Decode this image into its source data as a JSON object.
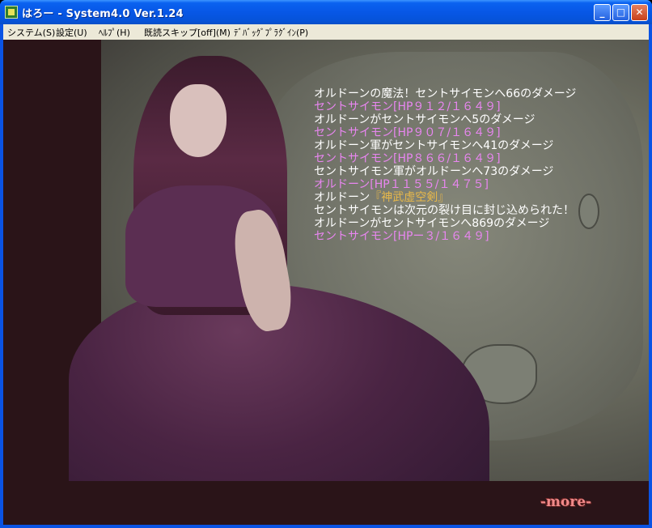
{
  "window": {
    "title": "はろー - System4.0 Ver.1.24",
    "minimize_label": "_",
    "maximize_label": "□",
    "close_label": "✕"
  },
  "menu": [
    {
      "label": "システム(S)"
    },
    {
      "label": "設定(U)"
    },
    {
      "label": "ﾍﾙﾌﾟ(H)"
    },
    {
      "label": "既読スキップ[off](M)"
    },
    {
      "label": "ﾃﾞﾊﾞｯｸﾞﾌﾟﾗｸﾞｲﾝ(P)"
    }
  ],
  "battle_log": [
    {
      "text": "オルドーンの魔法！セントサイモンへ66のダメージ",
      "color": "white"
    },
    {
      "text": "セントサイモン[HP９１２/１６４９]",
      "color": "pink"
    },
    {
      "text": "オルドーンがセントサイモンへ5のダメージ",
      "color": "white"
    },
    {
      "text": "セントサイモン[HP９０７/１６４９]",
      "color": "pink"
    },
    {
      "text": "オルドーン軍がセントサイモンへ41のダメージ",
      "color": "white"
    },
    {
      "text": "セントサイモン[HP８６６/１６４９]",
      "color": "pink"
    },
    {
      "text": "セントサイモン軍がオルドーンへ73のダメージ",
      "color": "white"
    },
    {
      "text": "オルドーン[HP１１５５/１４７５]",
      "color": "pink"
    },
    {
      "text": "オルドーン",
      "color": "white",
      "suffix": "『神武虚空剣』",
      "suffix_color": "gold"
    },
    {
      "text": "セントサイモンは次元の裂け目に封じ込められた！",
      "color": "white"
    },
    {
      "text": "オルドーンがセントサイモンへ869のダメージ",
      "color": "white"
    },
    {
      "text": "セントサイモン[HPー３/１６４９]",
      "color": "pink"
    }
  ],
  "more_prompt": "-more-"
}
